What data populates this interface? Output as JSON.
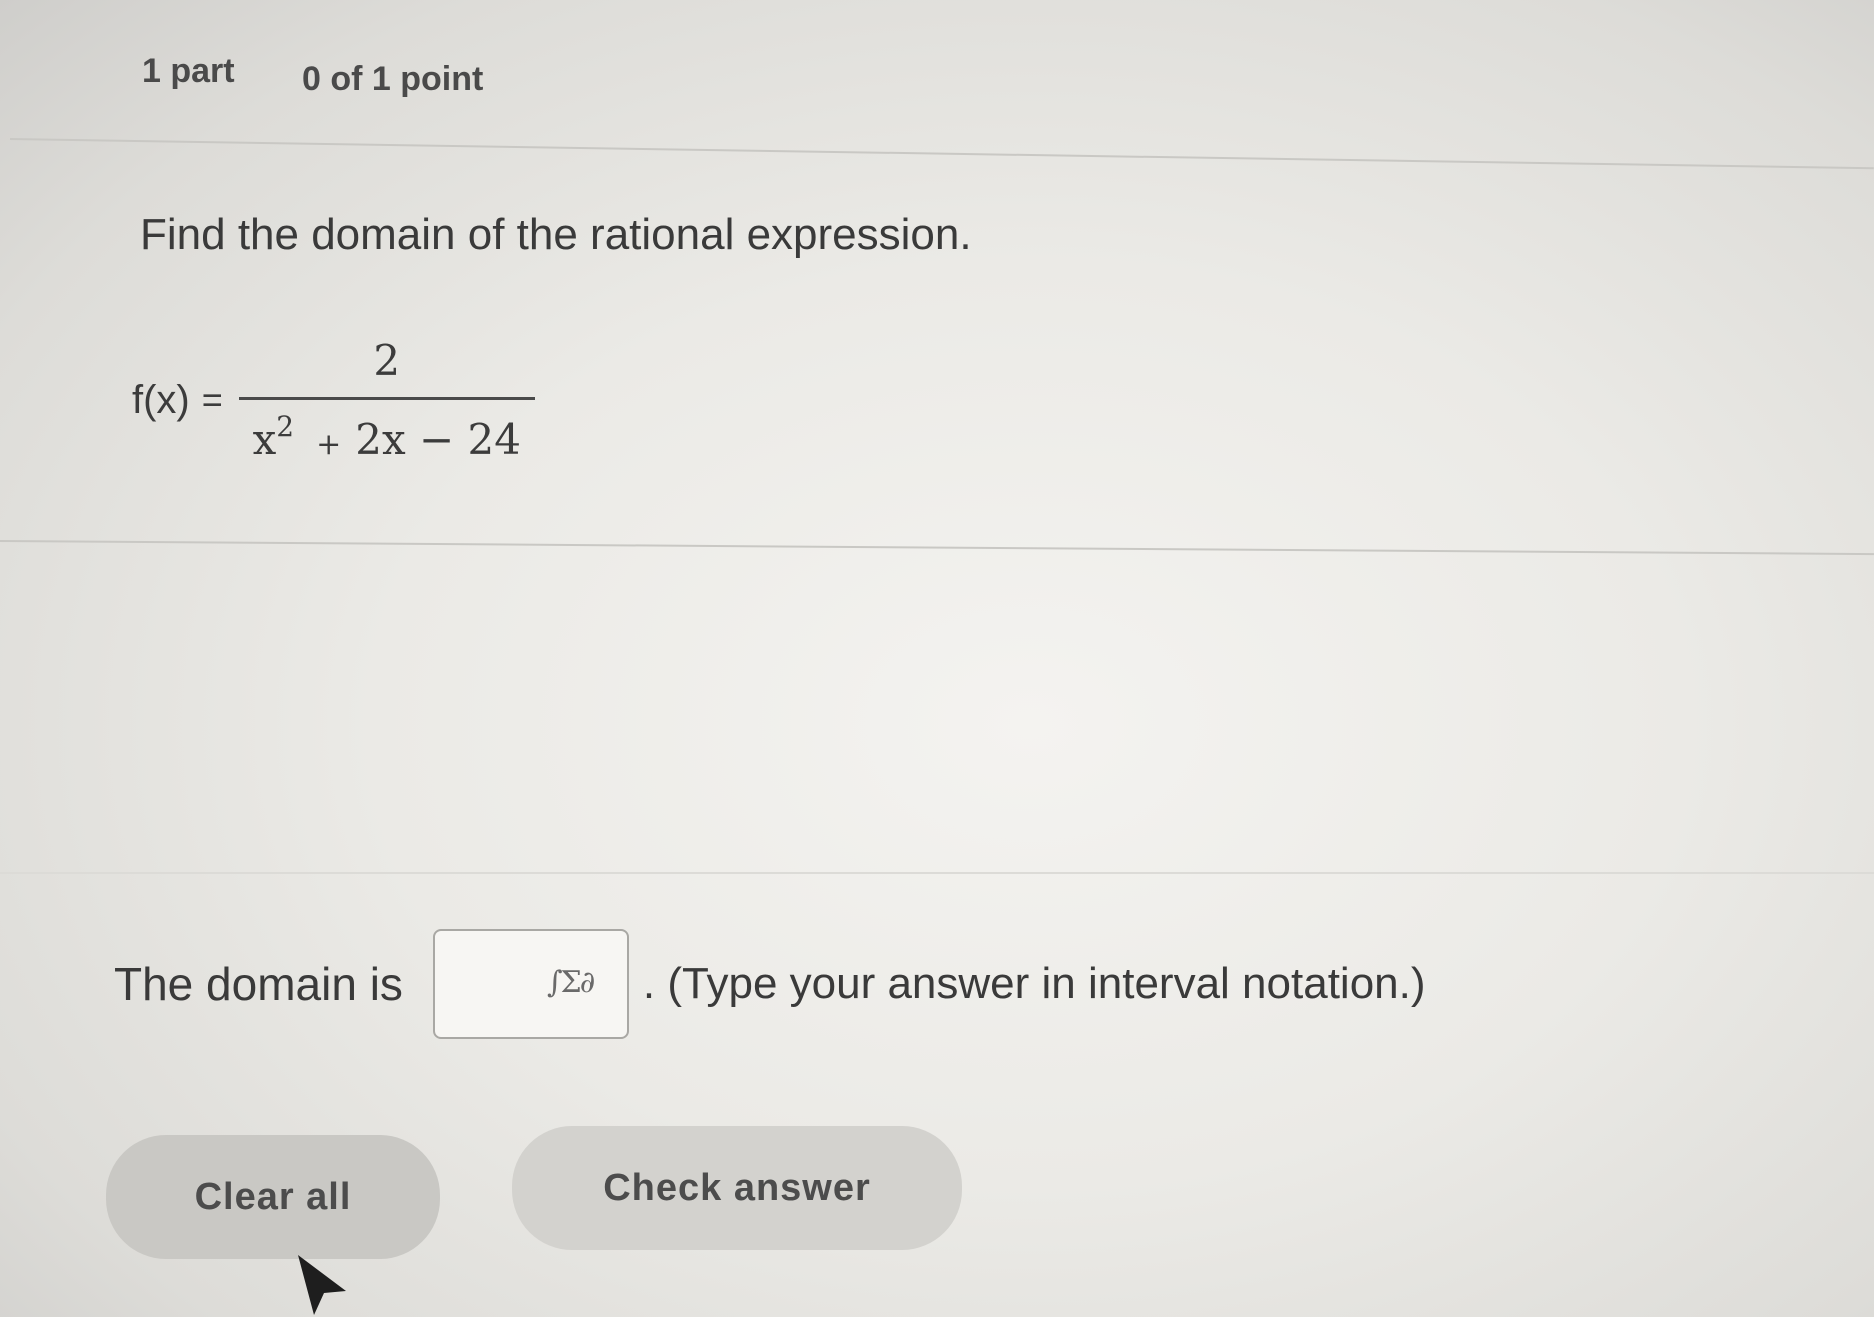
{
  "header": {
    "parts": "1 part",
    "points": "0 of 1 point"
  },
  "question": {
    "prompt": "Find the domain of the rational expression.",
    "function_label": "f(x)",
    "equals": "=",
    "numerator": "2",
    "denominator": {
      "x": "x",
      "exponent": "2",
      "plus": "+",
      "rest": "2x − 24"
    }
  },
  "answer": {
    "label": "The domain is",
    "value": "",
    "math_palette_icon": "∫Σ∂",
    "instruction": ". (Type your answer in interval notation.)"
  },
  "buttons": {
    "clear_all": "Clear all",
    "check_answer": "Check answer"
  },
  "icons": {
    "math_palette": "math-palette-icon",
    "cursor": "mouse-pointer-icon"
  }
}
